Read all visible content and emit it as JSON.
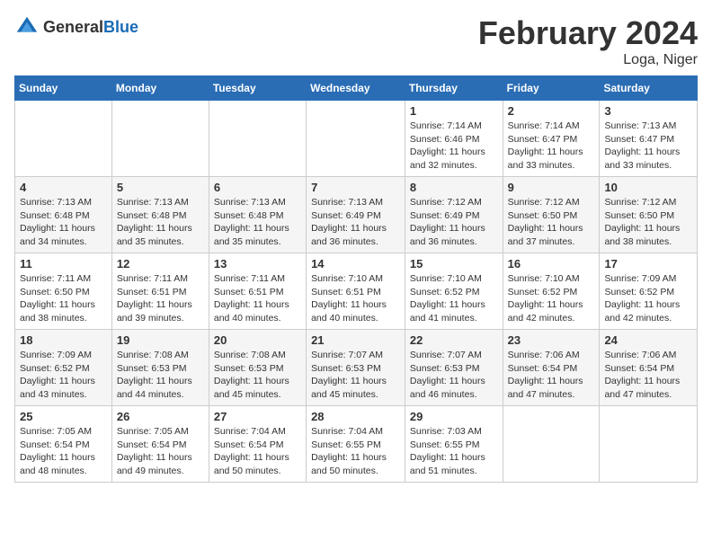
{
  "header": {
    "logo_general": "General",
    "logo_blue": "Blue",
    "month_title": "February 2024",
    "location": "Loga, Niger"
  },
  "columns": [
    "Sunday",
    "Monday",
    "Tuesday",
    "Wednesday",
    "Thursday",
    "Friday",
    "Saturday"
  ],
  "weeks": [
    [
      {
        "day": "",
        "info": ""
      },
      {
        "day": "",
        "info": ""
      },
      {
        "day": "",
        "info": ""
      },
      {
        "day": "",
        "info": ""
      },
      {
        "day": "1",
        "info": "Sunrise: 7:14 AM\nSunset: 6:46 PM\nDaylight: 11 hours\nand 32 minutes."
      },
      {
        "day": "2",
        "info": "Sunrise: 7:14 AM\nSunset: 6:47 PM\nDaylight: 11 hours\nand 33 minutes."
      },
      {
        "day": "3",
        "info": "Sunrise: 7:13 AM\nSunset: 6:47 PM\nDaylight: 11 hours\nand 33 minutes."
      }
    ],
    [
      {
        "day": "4",
        "info": "Sunrise: 7:13 AM\nSunset: 6:48 PM\nDaylight: 11 hours\nand 34 minutes."
      },
      {
        "day": "5",
        "info": "Sunrise: 7:13 AM\nSunset: 6:48 PM\nDaylight: 11 hours\nand 35 minutes."
      },
      {
        "day": "6",
        "info": "Sunrise: 7:13 AM\nSunset: 6:48 PM\nDaylight: 11 hours\nand 35 minutes."
      },
      {
        "day": "7",
        "info": "Sunrise: 7:13 AM\nSunset: 6:49 PM\nDaylight: 11 hours\nand 36 minutes."
      },
      {
        "day": "8",
        "info": "Sunrise: 7:12 AM\nSunset: 6:49 PM\nDaylight: 11 hours\nand 36 minutes."
      },
      {
        "day": "9",
        "info": "Sunrise: 7:12 AM\nSunset: 6:50 PM\nDaylight: 11 hours\nand 37 minutes."
      },
      {
        "day": "10",
        "info": "Sunrise: 7:12 AM\nSunset: 6:50 PM\nDaylight: 11 hours\nand 38 minutes."
      }
    ],
    [
      {
        "day": "11",
        "info": "Sunrise: 7:11 AM\nSunset: 6:50 PM\nDaylight: 11 hours\nand 38 minutes."
      },
      {
        "day": "12",
        "info": "Sunrise: 7:11 AM\nSunset: 6:51 PM\nDaylight: 11 hours\nand 39 minutes."
      },
      {
        "day": "13",
        "info": "Sunrise: 7:11 AM\nSunset: 6:51 PM\nDaylight: 11 hours\nand 40 minutes."
      },
      {
        "day": "14",
        "info": "Sunrise: 7:10 AM\nSunset: 6:51 PM\nDaylight: 11 hours\nand 40 minutes."
      },
      {
        "day": "15",
        "info": "Sunrise: 7:10 AM\nSunset: 6:52 PM\nDaylight: 11 hours\nand 41 minutes."
      },
      {
        "day": "16",
        "info": "Sunrise: 7:10 AM\nSunset: 6:52 PM\nDaylight: 11 hours\nand 42 minutes."
      },
      {
        "day": "17",
        "info": "Sunrise: 7:09 AM\nSunset: 6:52 PM\nDaylight: 11 hours\nand 42 minutes."
      }
    ],
    [
      {
        "day": "18",
        "info": "Sunrise: 7:09 AM\nSunset: 6:52 PM\nDaylight: 11 hours\nand 43 minutes."
      },
      {
        "day": "19",
        "info": "Sunrise: 7:08 AM\nSunset: 6:53 PM\nDaylight: 11 hours\nand 44 minutes."
      },
      {
        "day": "20",
        "info": "Sunrise: 7:08 AM\nSunset: 6:53 PM\nDaylight: 11 hours\nand 45 minutes."
      },
      {
        "day": "21",
        "info": "Sunrise: 7:07 AM\nSunset: 6:53 PM\nDaylight: 11 hours\nand 45 minutes."
      },
      {
        "day": "22",
        "info": "Sunrise: 7:07 AM\nSunset: 6:53 PM\nDaylight: 11 hours\nand 46 minutes."
      },
      {
        "day": "23",
        "info": "Sunrise: 7:06 AM\nSunset: 6:54 PM\nDaylight: 11 hours\nand 47 minutes."
      },
      {
        "day": "24",
        "info": "Sunrise: 7:06 AM\nSunset: 6:54 PM\nDaylight: 11 hours\nand 47 minutes."
      }
    ],
    [
      {
        "day": "25",
        "info": "Sunrise: 7:05 AM\nSunset: 6:54 PM\nDaylight: 11 hours\nand 48 minutes."
      },
      {
        "day": "26",
        "info": "Sunrise: 7:05 AM\nSunset: 6:54 PM\nDaylight: 11 hours\nand 49 minutes."
      },
      {
        "day": "27",
        "info": "Sunrise: 7:04 AM\nSunset: 6:54 PM\nDaylight: 11 hours\nand 50 minutes."
      },
      {
        "day": "28",
        "info": "Sunrise: 7:04 AM\nSunset: 6:55 PM\nDaylight: 11 hours\nand 50 minutes."
      },
      {
        "day": "29",
        "info": "Sunrise: 7:03 AM\nSunset: 6:55 PM\nDaylight: 11 hours\nand 51 minutes."
      },
      {
        "day": "",
        "info": ""
      },
      {
        "day": "",
        "info": ""
      }
    ]
  ]
}
